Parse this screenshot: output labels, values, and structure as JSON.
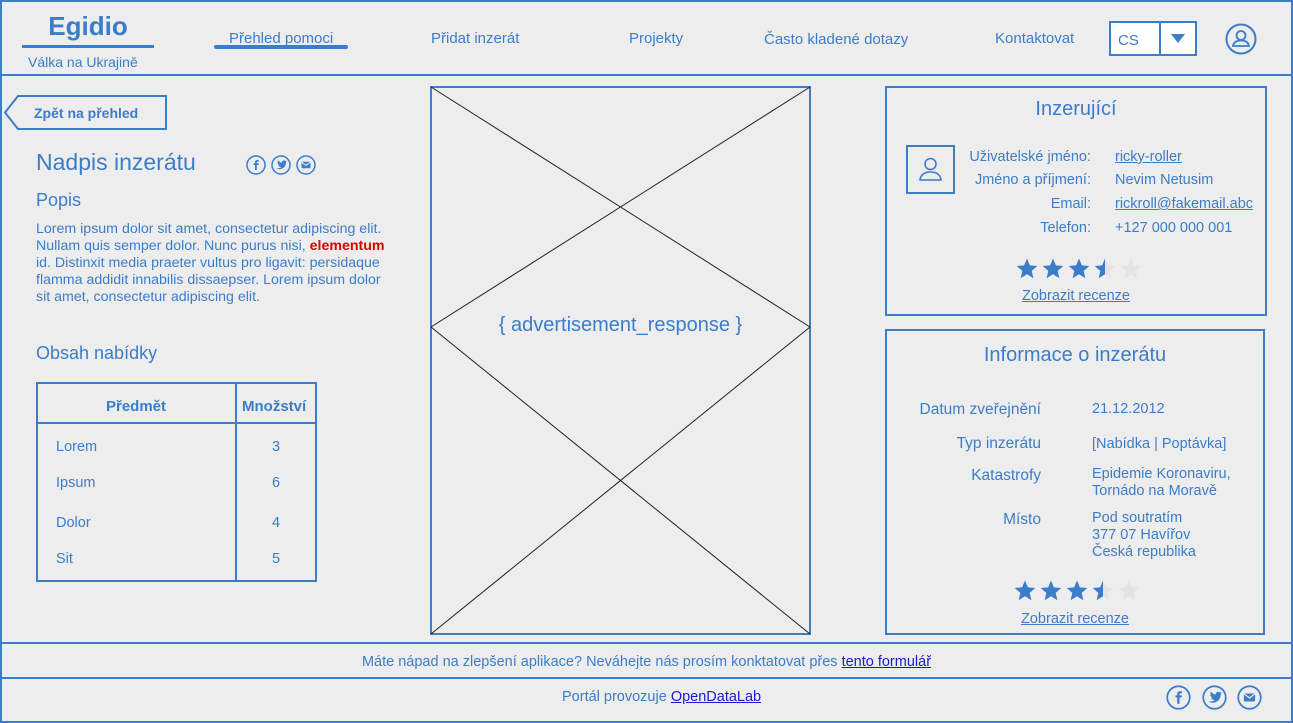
{
  "header": {
    "logo_title": "Egidio",
    "logo_subtitle": "Válka na Ukrajině",
    "nav": [
      "Přehled pomoci",
      "Přidat inzerát",
      "Projekty",
      "Často kladené dotazy",
      "Kontaktovat"
    ],
    "language": "CS"
  },
  "back_button": "Zpět na přehled",
  "ad": {
    "title": "Nadpis inzerátu",
    "description_heading": "Popis",
    "description_part1": "Lorem ipsum dolor sit amet, consectetur adipiscing elit. Nullam quis semper dolor. Nunc purus nisi, ",
    "description_highlight": "elementum",
    "description_part2": " id. Distinxit  media praeter vultus pro ligavit: persidaque flamma addidit innabilis dissaepser. Lorem ipsum dolor sit amet, consectetur adipiscing elit.",
    "offer_heading": "Obsah nabídky",
    "table": {
      "headers": [
        "Předmět",
        "Množství"
      ],
      "rows": [
        {
          "item": "Lorem",
          "qty": "3"
        },
        {
          "item": "Ipsum",
          "qty": "6"
        },
        {
          "item": "Dolor",
          "qty": "4"
        },
        {
          "item": "Sit",
          "qty": "5"
        }
      ]
    },
    "image_placeholder": "{ advertisement_response }"
  },
  "advertiser": {
    "title": "Inzerující",
    "labels": [
      "Uživatelské jméno:",
      "Jméno a příjmení:",
      "Email:",
      "Telefon:"
    ],
    "username": "ricky-roller",
    "full_name": "Nevim Netusim",
    "email": "rickroll@fakemail.abc",
    "phone": "+127 000 000 001",
    "rating": 3.5,
    "reviews_link": "Zobrazit recenze"
  },
  "ad_info": {
    "title": "Informace o inzerátu",
    "labels": [
      "Datum zveřejnění",
      "Typ inzerátu",
      "Katastrofy",
      "Místo"
    ],
    "date": "21.12.2012",
    "type": "[Nabídka | Poptávka]",
    "disasters": [
      "Epidemie Koronaviru,",
      "Tornádo na Moravě"
    ],
    "place": [
      "Pod soutratím",
      "377 07 Havířov",
      "Česká republika"
    ],
    "rating": 3.5,
    "reviews_link": "Zobrazit recenze"
  },
  "footer": {
    "feedback_text": "Máte nápad na zlepšení aplikace? Neváhejte nás prosím konktatovat přes ",
    "feedback_link": "tento formulář",
    "operator_text": "Portál provozuje ",
    "operator_link": "OpenDataLab"
  },
  "colors": {
    "accent": "#3b7dc9",
    "background": "#ededed",
    "highlight": "#e00000",
    "link": "#1a1ad0"
  }
}
